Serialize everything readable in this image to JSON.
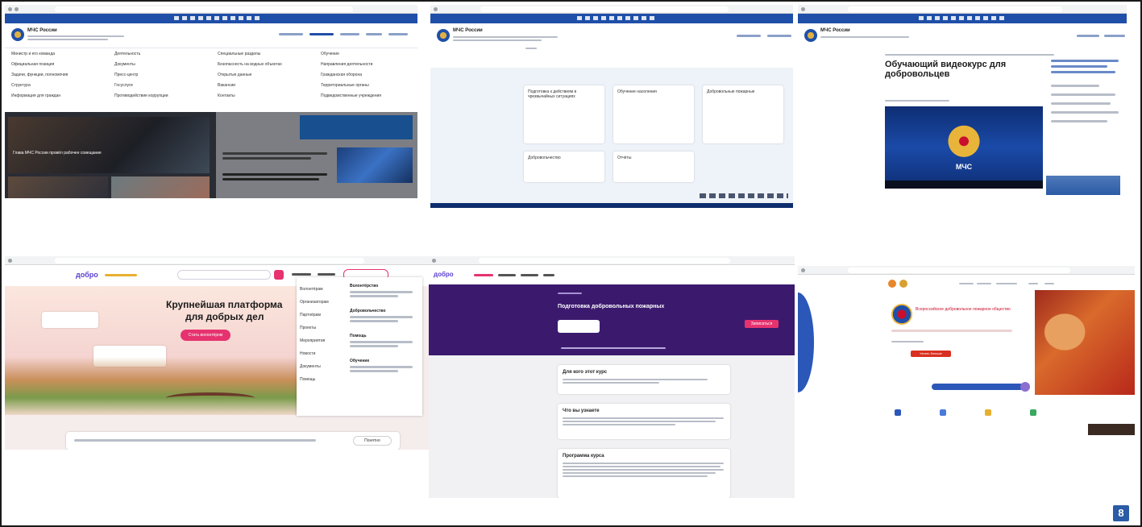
{
  "colors": {
    "mchs_blue": "#1f4fa8",
    "mchs_dark": "#0d2d6e",
    "dobro_pink": "#e6336f",
    "dobro_purple": "#3b1a6e",
    "accent_orange": "#e8862a"
  },
  "panel1": {
    "site_title": "МЧС России",
    "menu_columns": [
      [
        "Министр и его команда",
        "Официальная позиция",
        "Задачи, функции, полномочия",
        "Структура",
        "Информация для граждан"
      ],
      [
        "Деятельность",
        "Документы",
        "Пресс-центр",
        "Госуслуги",
        "Противодействие коррупции"
      ],
      [
        "Специальные разделы",
        "Безопасность на водных объектах",
        "Открытые данные",
        "Вакансии",
        "Контакты"
      ],
      [
        "Обучение",
        "Направления деятельности",
        "Гражданская оборона",
        "Территориальные органы",
        "Подведомственные учреждения"
      ]
    ],
    "news_text": "Глава МЧС России провёл рабочее совещание"
  },
  "panel2": {
    "site_title": "МЧС России",
    "cards": [
      "Подготовка к действиям в чрезвычайных ситуациях",
      "Обучение населения",
      "Добровольные пожарные",
      "Добровольчество",
      "Отчёты"
    ]
  },
  "panel3": {
    "site_title": "МЧС России",
    "headline": "Обучающий видеокурс для добровольцев",
    "video_label": "МЧС"
  },
  "panel4": {
    "logo": "добро",
    "headline_1": "Крупнейшая платформа",
    "headline_2": "для добрых дел",
    "cta": "Стать волонтёром",
    "dropdown_items": [
      "Волонтёрам",
      "Организаторам",
      "Партнёрам",
      "Проекты",
      "Мероприятия",
      "Новости",
      "Документы",
      "Помощь"
    ],
    "side_headings": [
      "Волонтёрство",
      "Добровольчество",
      "Помощь",
      "Обучение"
    ],
    "cookie_button": "Понятно"
  },
  "panel5": {
    "logo": "добро",
    "hero_title": "Подготовка добровольных пожарных",
    "hero_button": "Записаться",
    "sections": [
      "Для кого этот курс",
      "Что вы узнаете",
      "Программа курса"
    ]
  },
  "panel6": {
    "org_title": "Всероссийское добровольное пожарное общество",
    "cta": "Узнать больше"
  },
  "corner_badge": "8"
}
